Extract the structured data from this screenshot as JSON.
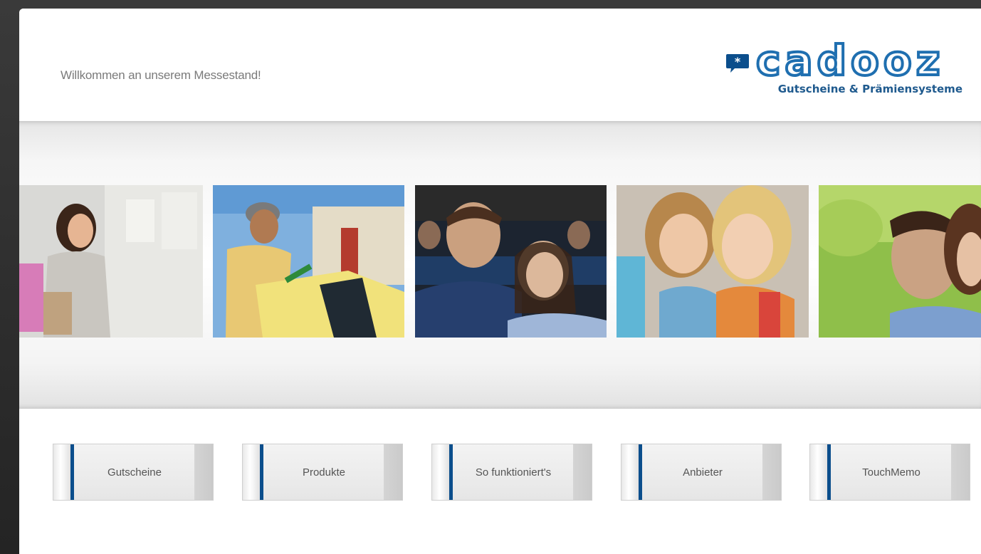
{
  "header": {
    "welcome": "Willkommen an unserem Messestand!",
    "logo_word": "cadooz",
    "logo_tagline": "Gutscheine & Prämiensysteme"
  },
  "photos": [
    {
      "name": "photo-woman-shopping"
    },
    {
      "name": "photo-man-gas-station"
    },
    {
      "name": "photo-couple-cinema"
    },
    {
      "name": "photo-girls-shopping"
    },
    {
      "name": "photo-couple-outdoors"
    }
  ],
  "nav": {
    "items": [
      {
        "label": "Gutscheine"
      },
      {
        "label": "Produkte"
      },
      {
        "label": "So funktioniert's"
      },
      {
        "label": "Anbieter"
      },
      {
        "label": "TouchMemo"
      }
    ]
  },
  "colors": {
    "accent": "#0b4e8c",
    "brand": "#1f6fb0"
  }
}
